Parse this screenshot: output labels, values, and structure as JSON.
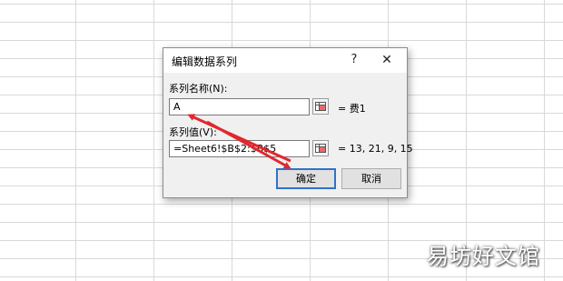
{
  "dialog": {
    "title": "编辑数据系列",
    "help_label": "?",
    "close_label": "✕"
  },
  "series_name": {
    "label": "系列名称(N):",
    "value": "A",
    "preview": "= 费1"
  },
  "series_values": {
    "label": "系列值(V):",
    "value": "=Sheet6!$B$2:$B$5",
    "preview": "= 13, 21, 9, 15"
  },
  "buttons": {
    "ok": "确定",
    "cancel": "取消"
  },
  "watermark": "易坊好文馆",
  "colors": {
    "annotation_arrow": "#e0282d",
    "default_button_border": "#2f72c8"
  }
}
